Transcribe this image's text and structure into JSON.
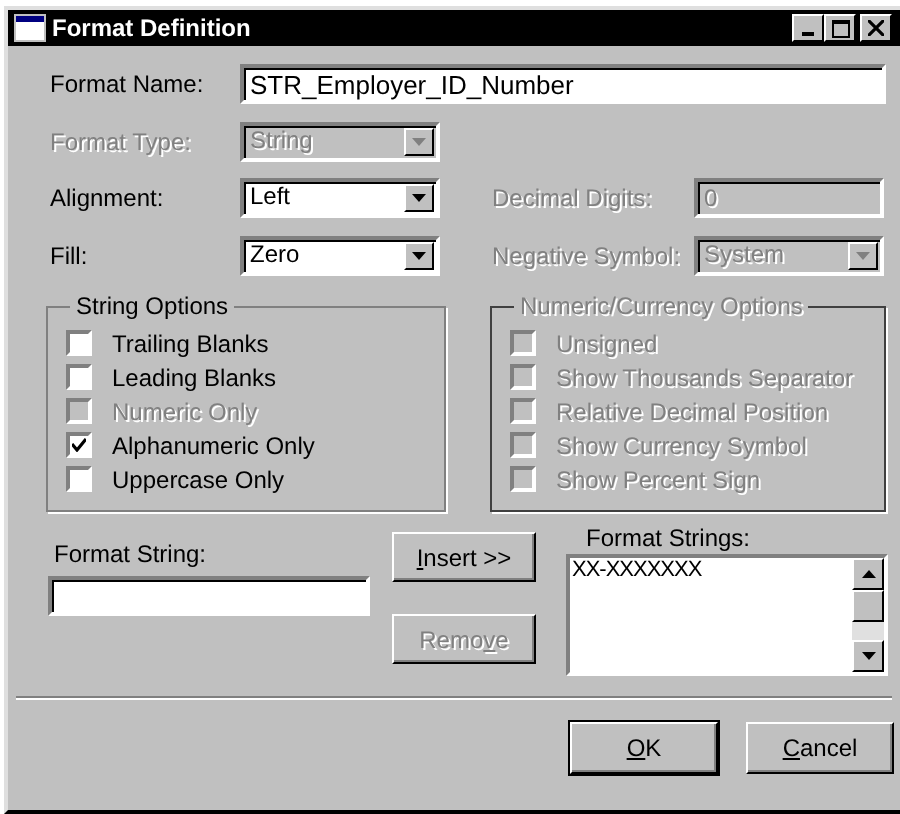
{
  "window": {
    "title": "Format Definition"
  },
  "format_name": {
    "label": "Format Name:",
    "value": "STR_Employer_ID_Number",
    "disabled": false
  },
  "format_type": {
    "label": "Format Type:",
    "value": "String",
    "disabled": true
  },
  "alignment": {
    "label": "Alignment:",
    "value": "Left",
    "disabled": false
  },
  "decimal_digits": {
    "label": "Decimal Digits:",
    "value": "0",
    "disabled": true
  },
  "fill": {
    "label": "Fill:",
    "value": "Zero",
    "disabled": false
  },
  "negative_symbol": {
    "label": "Negative Symbol:",
    "value": "System",
    "disabled": true
  },
  "string_options": {
    "title": "String Options",
    "disabled": false,
    "options": [
      {
        "label": "Trailing Blanks",
        "checked": false,
        "disabled": false
      },
      {
        "label": "Leading Blanks",
        "checked": false,
        "disabled": false
      },
      {
        "label": "Numeric Only",
        "checked": false,
        "disabled": true
      },
      {
        "label": "Alphanumeric Only",
        "checked": true,
        "disabled": false
      },
      {
        "label": "Uppercase Only",
        "checked": false,
        "disabled": false
      }
    ]
  },
  "numeric_options": {
    "title": "Numeric/Currency Options",
    "disabled": true,
    "options": [
      {
        "label": "Unsigned",
        "checked": false,
        "disabled": true
      },
      {
        "label": "Show Thousands Separator",
        "checked": false,
        "disabled": true
      },
      {
        "label": "Relative Decimal Position",
        "checked": false,
        "disabled": true
      },
      {
        "label": "Show Currency Symbol",
        "checked": false,
        "disabled": true
      },
      {
        "label": "Show Percent Sign",
        "checked": false,
        "disabled": true
      }
    ]
  },
  "format_string": {
    "label": "Format String:"
  },
  "insert_button": {
    "key": "I",
    "post": "nsert >>",
    "disabled": false
  },
  "remove_button": {
    "pre": "Remo",
    "key": "v",
    "post": "e",
    "disabled": true
  },
  "format_strings": {
    "label": "Format Strings:",
    "items": [
      "XX-XXXXXXX"
    ]
  },
  "ok_button": {
    "key": "O",
    "post": "K",
    "default": true
  },
  "cancel_button": {
    "key": "C",
    "post": "ancel",
    "default": false
  }
}
